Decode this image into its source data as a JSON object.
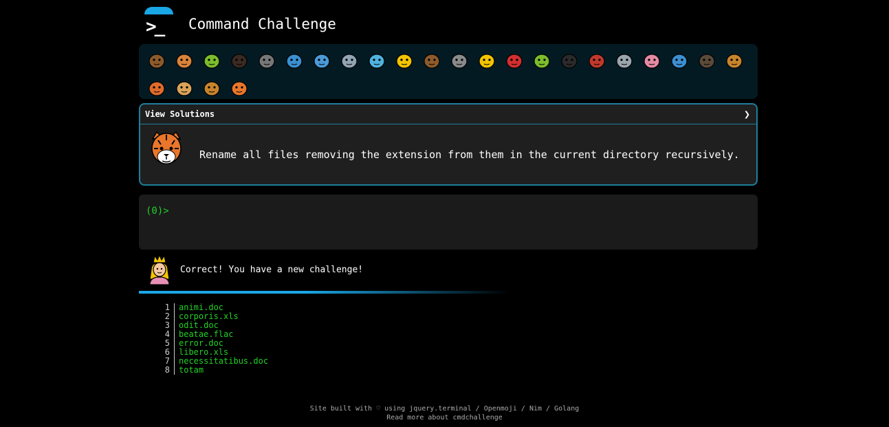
{
  "header": {
    "title": "Command Challenge"
  },
  "achievements": [
    {
      "name": "snail-icon",
      "color": "#8d5a2b"
    },
    {
      "name": "butterfly-icon",
      "color": "#d9833a"
    },
    {
      "name": "caterpillar-icon",
      "color": "#7bbd2c"
    },
    {
      "name": "ant-icon",
      "color": "#3a2a22"
    },
    {
      "name": "microbe-icon",
      "color": "#777777"
    },
    {
      "name": "whale-icon",
      "color": "#3b8fd0"
    },
    {
      "name": "shark-icon",
      "color": "#4a9ad8"
    },
    {
      "name": "dolphin-icon",
      "color": "#92a4b3"
    },
    {
      "name": "fish-icon",
      "color": "#4fb3e0"
    },
    {
      "name": "tropical-fish-icon",
      "color": "#f2c400"
    },
    {
      "name": "monkey-face-icon",
      "color": "#8d5a2b"
    },
    {
      "name": "wolf-icon",
      "color": "#8a8a8a"
    },
    {
      "name": "bee-icon",
      "color": "#f2c400"
    },
    {
      "name": "ladybug-icon",
      "color": "#d22f2f"
    },
    {
      "name": "worm-icon",
      "color": "#7bbd2c"
    },
    {
      "name": "spider-icon",
      "color": "#2a2a2a"
    },
    {
      "name": "scorpion-icon",
      "color": "#c0392b"
    },
    {
      "name": "fly-icon",
      "color": "#9aa5ad"
    },
    {
      "name": "earthworm-icon",
      "color": "#e68aa4"
    },
    {
      "name": "protozoa-icon",
      "color": "#3b8fd0"
    },
    {
      "name": "gorilla-icon",
      "color": "#5a4a3a"
    },
    {
      "name": "dog-face-icon",
      "color": "#c8842c"
    },
    {
      "name": "fox-icon",
      "color": "#e06b2c"
    },
    {
      "name": "cat-face-icon",
      "color": "#d9a35a"
    },
    {
      "name": "lion-icon",
      "color": "#c8842c"
    },
    {
      "name": "tiger-face-icon",
      "color": "#e9762b"
    }
  ],
  "solutions": {
    "title": "View Solutions",
    "chevron": "❯",
    "challenge": "Rename all files removing the extension from them in the current directory recursively."
  },
  "terminal": {
    "prompt": "(0)>"
  },
  "message": {
    "text": "Correct! You have a new challenge!"
  },
  "files": [
    {
      "num": "1",
      "name": "animi.doc"
    },
    {
      "num": "2",
      "name": "corporis.xls"
    },
    {
      "num": "3",
      "name": "odit.doc"
    },
    {
      "num": "4",
      "name": "beatae.flac"
    },
    {
      "num": "5",
      "name": "error.doc"
    },
    {
      "num": "6",
      "name": "libero.xls"
    },
    {
      "num": "7",
      "name": "necessitatibus.doc"
    },
    {
      "num": "8",
      "name": "totam"
    }
  ],
  "footer": {
    "line1_prefix": "Site built with ♡ using",
    "links": [
      "jquery.terminal",
      "Openmoji",
      "Nim",
      "Golang"
    ],
    "separator": "/",
    "line2": "Read more about cmdchallenge"
  }
}
